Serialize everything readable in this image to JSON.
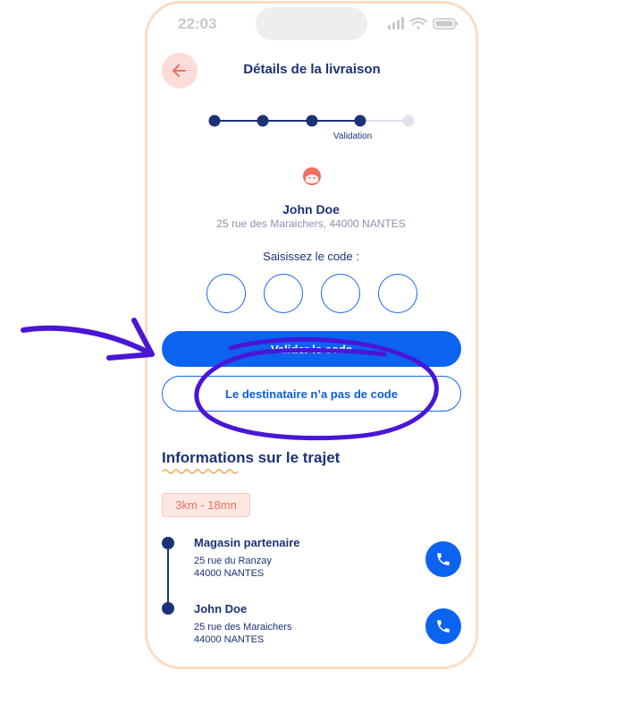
{
  "status_bar": {
    "time": "22:03"
  },
  "header": {
    "title": "Détails de la livraison"
  },
  "stepper": {
    "active_step_label": "Validation",
    "total_steps": 5,
    "completed_steps": 4
  },
  "recipient": {
    "name": "John Doe",
    "address": "25 rue des Maraichers, 44000 NANTES"
  },
  "code_entry": {
    "label": "Saisissez le code :",
    "digits": [
      "",
      "",
      "",
      ""
    ]
  },
  "buttons": {
    "validate": "Valider le code",
    "no_code": "Le destinataire n’a pas de code"
  },
  "trip": {
    "title": "Informations sur le trajet",
    "distance_time": "3km - 18mn",
    "stops": [
      {
        "name": "Magasin partenaire",
        "street": "25 rue du Ranzay",
        "city": "44000 NANTES"
      },
      {
        "name": "John Doe",
        "street": "25 rue des Maraichers",
        "city": "44000 NANTES"
      }
    ]
  },
  "colors": {
    "primary": "#0b63f0",
    "navy": "#1c3276",
    "accent_salmon": "#ee7060",
    "phone_border": "#fbdcc2",
    "annotation": "#4a16d6"
  }
}
